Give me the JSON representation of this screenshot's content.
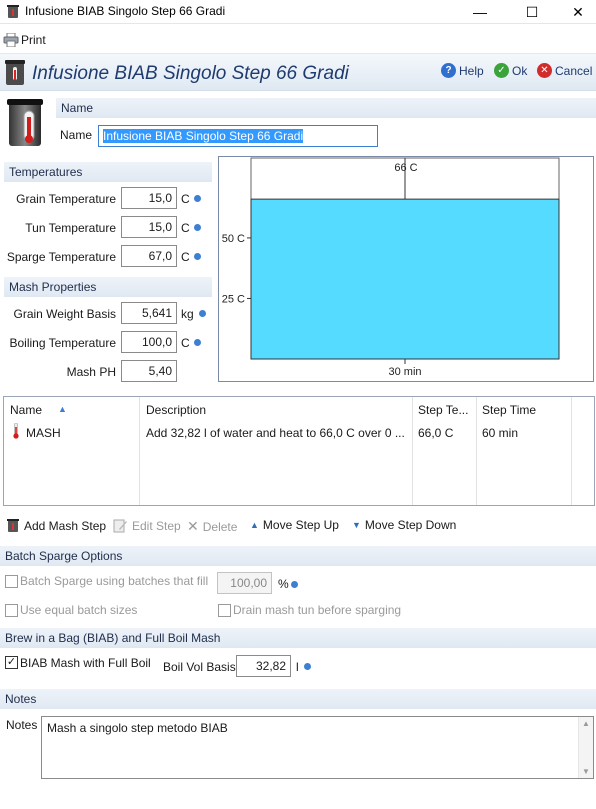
{
  "window": {
    "title": "Infusione BIAB Singolo Step 66 Gradi",
    "minimize": "—",
    "maximize": "☐",
    "close": "✕"
  },
  "toolbar": {
    "print_label": "Print"
  },
  "header": {
    "title": "Infusione BIAB Singolo Step 66 Gradi",
    "help_label": "Help",
    "ok_label": "Ok",
    "cancel_label": "Cancel"
  },
  "name_section": {
    "heading": "Name",
    "name_label": "Name",
    "name_value": "Infusione BIAB Singolo Step 66 Gradi"
  },
  "temperatures": {
    "heading": "Temperatures",
    "grain": {
      "label": "Grain Temperature",
      "value": "15,0",
      "unit": "C"
    },
    "tun": {
      "label": "Tun Temperature",
      "value": "15,0",
      "unit": "C"
    },
    "sparge": {
      "label": "Sparge Temperature",
      "value": "67,0",
      "unit": "C"
    }
  },
  "mash_properties": {
    "heading": "Mash Properties",
    "grain_weight": {
      "label": "Grain Weight Basis",
      "value": "5,641",
      "unit": "kg"
    },
    "boiling": {
      "label": "Boiling Temperature",
      "value": "100,0",
      "unit": "C"
    },
    "ph": {
      "label": "Mash PH",
      "value": "5,40"
    }
  },
  "chart_data": {
    "type": "area",
    "x": [
      0,
      60
    ],
    "y": [
      66,
      66
    ],
    "xtick_labels": [
      "30 min"
    ],
    "ytick_labels": [
      "50 C",
      "25 C"
    ],
    "annotations": [
      "66 C"
    ],
    "fill_color": "#55dbff"
  },
  "steps_table": {
    "headers": [
      "Name",
      "Description",
      "Step Te...",
      "Step Time"
    ],
    "rows": [
      {
        "name": "MASH",
        "description": "Add 32,82 l of water and heat to 66,0 C over 0 ...",
        "temp": "66,0 C",
        "time": "60 min"
      }
    ]
  },
  "step_toolbar": {
    "add": "Add Mash Step",
    "edit": "Edit Step",
    "delete": "Delete",
    "up": "Move Step Up",
    "down": "Move Step Down"
  },
  "batch_sparge": {
    "heading": "Batch Sparge Options",
    "batches_label": "Batch Sparge using batches that fill",
    "batches_value": "100,00",
    "batches_unit": "%",
    "equal_label": "Use equal batch sizes",
    "drain_label": "Drain mash tun before sparging"
  },
  "biab": {
    "heading": "Brew in a Bag (BIAB) and Full Boil Mash",
    "checkbox_label": "BIAB Mash with Full Boil",
    "checked": true,
    "boil_label": "Boil Vol Basis",
    "boil_value": "32,82",
    "boil_unit": "l"
  },
  "notes": {
    "heading": "Notes",
    "label": "Notes",
    "value": "Mash a singolo step metodo BIAB"
  },
  "colors": {
    "accent": "#1f3b6e",
    "chart_fill": "#55dbff",
    "selection": "#3399ff"
  }
}
